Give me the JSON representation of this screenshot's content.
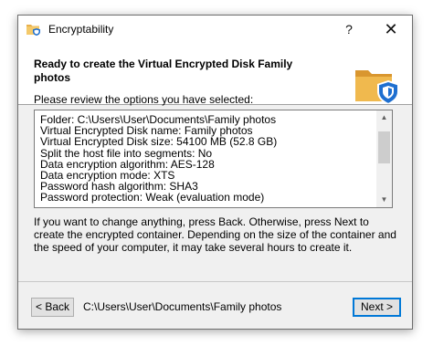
{
  "window": {
    "title": "Encryptability",
    "help_glyph": "?",
    "close_glyph": "✕"
  },
  "header": {
    "heading": "Ready to create the Virtual Encrypted Disk Family photos",
    "icon": "folder-shield-icon"
  },
  "prompt": "Please review the options you have selected:",
  "options": [
    "Folder: C:\\Users\\User\\Documents\\Family photos",
    "Virtual Encrypted Disk name: Family photos",
    "Virtual Encrypted Disk size: 54100 MB (52.8 GB)",
    "Split the host file into segments: No",
    "Data encryption algorithm: AES-128",
    "Data encryption mode: XTS",
    "Password hash algorithm: SHA3",
    "Password protection: Weak (evaluation mode)"
  ],
  "info_text": "If you want to change anything, press Back. Otherwise, press Next to create the encrypted container. Depending on the size of the container and the speed of your computer, it may take several hours to create it.",
  "footer": {
    "back_label": "< Back",
    "path": "C:\\Users\\User\\Documents\\Family photos",
    "next_label": "Next >"
  },
  "colors": {
    "accent": "#0078d7",
    "folder": "#e8b04b",
    "shield": "#1e6fd0"
  }
}
